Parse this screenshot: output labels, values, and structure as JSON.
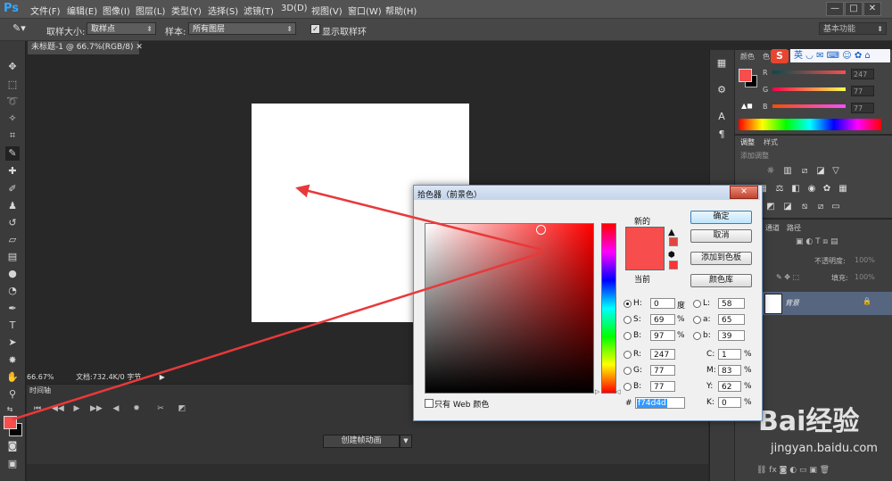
{
  "app": {
    "logo": "Ps"
  },
  "menu": [
    "文件(F)",
    "编辑(E)",
    "图像(I)",
    "图层(L)",
    "类型(Y)",
    "选择(S)",
    "滤镜(T)",
    "3D(D)",
    "视图(V)",
    "窗口(W)",
    "帮助(H)"
  ],
  "window_buttons": [
    "—",
    "□",
    "✕"
  ],
  "options": {
    "sample_size_label": "取样大小:",
    "sample_size_value": "取样点",
    "sample_label": "样本:",
    "sample_value": "所有图层",
    "show_ring_label": "显示取样环",
    "workspace": "基本功能"
  },
  "document": {
    "tab": "未标题-1 @ 66.7%(RGB/8)",
    "zoom": "66.67%",
    "doc_info": "文档:732.4K/0 字节"
  },
  "timeline": {
    "tab": "时间轴",
    "create_button": "创建帧动画"
  },
  "panels": {
    "color_tabs": [
      "颜色",
      "色"
    ],
    "ime": [
      "S",
      "英"
    ],
    "channels": [
      {
        "label": "R",
        "value": "247"
      },
      {
        "label": "G",
        "value": "77"
      },
      {
        "label": "B",
        "value": "77"
      }
    ],
    "adjust_tabs": [
      "调整",
      "样式"
    ],
    "adjust_add": "添加调整",
    "layers_tabs": [
      "通道",
      "路径"
    ],
    "opacity_label": "不透明度:",
    "opacity_value": "100%",
    "fill_label": "填充:",
    "fill_value": "100%",
    "layer_name": "背景"
  },
  "dialog": {
    "title": "拾色器（前景色）",
    "new_label": "新的",
    "current_label": "当前",
    "ok": "确定",
    "cancel": "取消",
    "add_swatch": "添加到色板",
    "color_lib": "颜色库",
    "web_only": "只有 Web 颜色",
    "hex_prefix": "#",
    "hex": "f74d4d",
    "hsb": {
      "h": "0",
      "s": "69",
      "b": "97",
      "h_unit": "度",
      "s_unit": "%",
      "b_unit": "%"
    },
    "rgb": {
      "r": "247",
      "g": "77",
      "b": "77"
    },
    "lab": {
      "l": "58",
      "a": "65",
      "b": "39"
    },
    "cmyk": {
      "c": "1",
      "m": "83",
      "y": "62",
      "k": "0",
      "unit": "%"
    },
    "labels": {
      "h": "H:",
      "s": "S:",
      "b": "B:",
      "r": "R:",
      "g": "G:",
      "bb": "B:",
      "l": "L:",
      "a": "a:",
      "lb": "b:",
      "c": "C:",
      "m": "M:",
      "y": "Y:",
      "k": "K:"
    }
  },
  "watermark": {
    "brand": "Bai经验",
    "url": "jingyan.baidu.com"
  },
  "colors": {
    "foreground": "#f74d4d",
    "annotation_arrow": "#e8393a",
    "accent_blue": "#31a8ff"
  }
}
